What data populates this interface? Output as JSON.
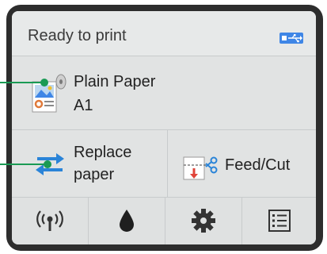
{
  "status": {
    "text": "Ready to print",
    "connection_icon": "usb-icon"
  },
  "paper": {
    "type": "Plain Paper",
    "size": "A1",
    "icon": "roll-paper-icon"
  },
  "actions": {
    "replace_line1": "Replace",
    "replace_line2": "paper",
    "replace_icon": "swap-arrows-icon",
    "feed_label": "Feed/Cut",
    "feed_icon": "scissors-icon"
  },
  "tabs": [
    "wireless-icon",
    "ink-drop-icon",
    "gear-icon",
    "list-icon"
  ],
  "colors": {
    "accent": "#1a9a54",
    "usb": "#3f86e6",
    "swap_arrows": "#2a84d8",
    "feed_arrow": "#e0443a"
  }
}
